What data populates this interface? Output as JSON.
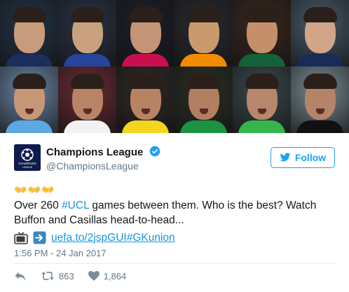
{
  "account": {
    "name": "Champions League",
    "handle": "@ChampionsLeague",
    "avatar_label_top": "CHAMPIONS",
    "avatar_label_bottom": "LEAGUE",
    "verified": true,
    "follow_label": "Follow"
  },
  "tweet": {
    "emoji_line": "👐👐👐",
    "text_before": "Over 260 ",
    "hashtag": "#UCL",
    "text_after": " games between them. Who is the best? Watch Buffon and Casillas head-to-head...",
    "link_text": "uefa.to/2jspGUI",
    "link_hashtag": "#GKunion",
    "timestamp": "1:56 PM - 24 Jan 2017"
  },
  "actions": {
    "reply_icon": "reply-icon",
    "retweet_icon": "retweet-icon",
    "retweet_count": "863",
    "like_icon": "heart-icon",
    "like_count": "1,864"
  },
  "colors": {
    "brand": "#1da1f2",
    "link": "#1b95e0",
    "muted": "#657786",
    "avatar_bg": "#0d1b4d"
  },
  "media_tiles": [
    {
      "bg": "#243447",
      "skin": "#c79b7b",
      "shirt": "#1b2d5a"
    },
    {
      "bg": "#2a3447",
      "skin": "#c9a17f",
      "shirt": "#24459b"
    },
    {
      "bg": "#1e202a",
      "skin": "#c49476",
      "shirt": "#c8104f"
    },
    {
      "bg": "#2a2b31",
      "skin": "#c9996e",
      "shirt": "#f28b00"
    },
    {
      "bg": "#3a281f",
      "skin": "#c4906c",
      "shirt": "#14623a"
    },
    {
      "bg": "#4a5b6b",
      "skin": "#d1a587",
      "shirt": "#182b59"
    },
    {
      "bg": "#6b86a6",
      "skin": "#c79877",
      "shirt": "#5da7e3"
    },
    {
      "bg": "#6b2c35",
      "skin": "#b98466",
      "shirt": "#f2f2f2"
    },
    {
      "bg": "#2f2a28",
      "skin": "#b88365",
      "shirt": "#f3d520"
    },
    {
      "bg": "#2a3026",
      "skin": "#b27f62",
      "shirt": "#1e9243"
    },
    {
      "bg": "#3b4a4f",
      "skin": "#b8876b",
      "shirt": "#35b44b"
    },
    {
      "bg": "#7a8c96",
      "skin": "#b58468",
      "shirt": "#111111"
    }
  ]
}
